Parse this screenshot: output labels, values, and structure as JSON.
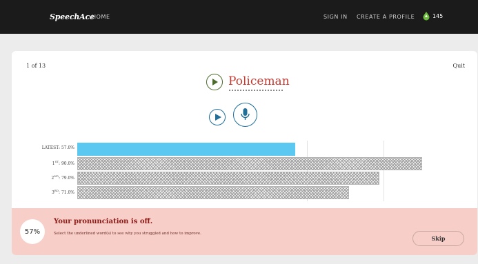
{
  "header": {
    "logo": "SpeechAce",
    "home": "HOME",
    "sign_in": "SIGN IN",
    "create_profile": "CREATE A PROFILE",
    "points": "145"
  },
  "lesson": {
    "counter": "1 of 13",
    "quit": "Quit",
    "word": "Policeman"
  },
  "scores": [
    {
      "label_prefix": "LATEST",
      "sup": "",
      "value": "57.0%",
      "fraction": 0.57
    },
    {
      "label_prefix": "1",
      "sup": "ST",
      "value": "90.0%",
      "fraction": 0.9
    },
    {
      "label_prefix": "2",
      "sup": "ND",
      "value": "79.0%",
      "fraction": 0.79
    },
    {
      "label_prefix": "3",
      "sup": "RD",
      "value": "71.0%",
      "fraction": 0.71
    }
  ],
  "feedback": {
    "score": "57%",
    "title": "Your pronunciation is off.",
    "subtitle": "Select the underlined word(s) to see why you struggled and how to improve.",
    "skip": "Skip"
  },
  "colors": {
    "word": "#c33a31",
    "latest_bar": "#5bc8f2",
    "feedback_bg": "#f7cfc8",
    "play_accent": "#4a6b2a",
    "record_accent": "#1f6f99"
  }
}
